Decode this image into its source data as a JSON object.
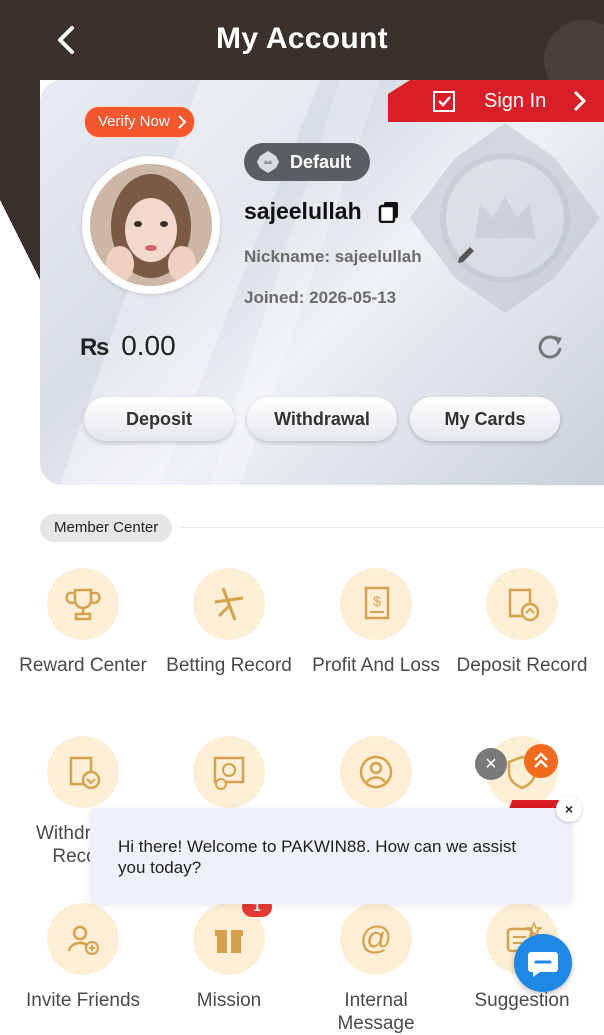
{
  "header": {
    "title": "My Account"
  },
  "card": {
    "sign_in": "Sign In",
    "verify": "Verify Now",
    "badge": "Default",
    "username": "sajeelullah",
    "nickname": "Nickname: sajeelullah",
    "joined": "Joined: 2026-05-13",
    "currency": "₨",
    "balance": "0.00",
    "actions": [
      "Deposit",
      "Withdrawal",
      "My Cards"
    ]
  },
  "member_center": {
    "title": "Member Center",
    "items": [
      {
        "label": "Reward Center",
        "icon": "trophy-icon"
      },
      {
        "label": "Betting Record",
        "icon": "betting-icon"
      },
      {
        "label": "Profit And Loss",
        "icon": "receipt-icon"
      },
      {
        "label": "Deposit Record",
        "icon": "deposit-record-icon"
      },
      {
        "label": "Withdrawal Record",
        "icon": "withdrawal-record-icon"
      },
      {
        "label": "",
        "icon": "report-icon"
      },
      {
        "label": "",
        "icon": "profile-icon"
      },
      {
        "label": "",
        "icon": "security-icon"
      },
      {
        "label": "Invite Friends",
        "icon": "invite-icon"
      },
      {
        "label": "Mission",
        "icon": "gift-icon"
      },
      {
        "label": "Internal Message",
        "icon": "at-icon"
      },
      {
        "label": "Suggestion",
        "icon": "suggestion-icon"
      }
    ]
  },
  "chat": {
    "message": "Hi there! Welcome to PAKWIN88. How can we assist you today?",
    "close": "×"
  },
  "overlay": {
    "dismiss": "×",
    "mission_badge": "1"
  },
  "colors": {
    "header": "#3a302c",
    "accent_red": "#d81e27",
    "gold": "#d4a24c",
    "icon_bg": "#fdeed6"
  }
}
